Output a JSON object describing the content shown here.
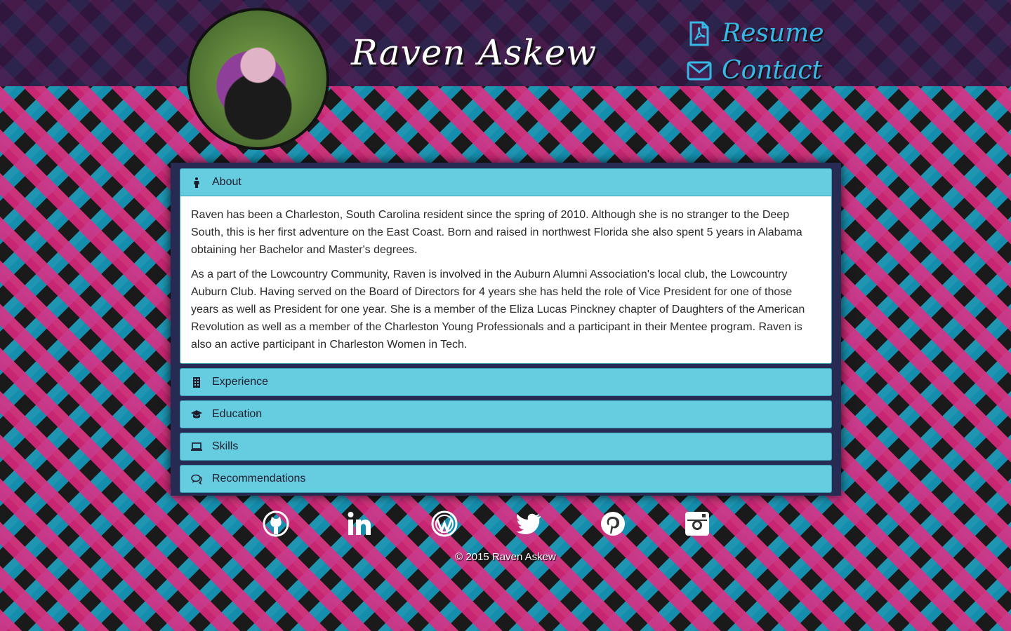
{
  "site": {
    "title": "Raven Askew",
    "avatar_alt": "profile-photo"
  },
  "nav": {
    "resume_label": "Resume",
    "contact_label": "Contact"
  },
  "sections": [
    {
      "label": "About",
      "icon": "person-icon"
    },
    {
      "label": "Experience",
      "icon": "building-icon"
    },
    {
      "label": "Education",
      "icon": "graduation-cap-icon"
    },
    {
      "label": "Skills",
      "icon": "laptop-icon"
    },
    {
      "label": "Recommendations",
      "icon": "comments-icon"
    }
  ],
  "about": {
    "paragraph1": "Raven has been a Charleston, South Carolina resident since the spring of 2010. Although she is no stranger to the Deep South, this is her first adventure on the East Coast. Born and raised in northwest Florida she also spent 5 years in Alabama obtaining her Bachelor and Master's degrees.",
    "paragraph2": "As a part of the Lowcountry Community, Raven is involved in the Auburn Alumni Association's local club, the Lowcountry Auburn Club. Having served on the Board of Directors for 4 years she has held the role of Vice President for one of those years as well as President for one year. She is a member of the Eliza Lucas Pinckney chapter of Daughters of the American Revolution as well as a member of the Charleston Young Professionals and a participant in their Mentee program. Raven is also an active participant in Charleston Women in Tech."
  },
  "social": [
    "github-icon",
    "linkedin-icon",
    "wordpress-icon",
    "twitter-icon",
    "pinterest-icon",
    "instagram-icon"
  ],
  "footer": {
    "copyright": "© 2015 Raven Askew"
  },
  "colors": {
    "accordion_header": "#66cde1",
    "panel_bg": "#272a52",
    "nav_link": "#38b8e6"
  }
}
